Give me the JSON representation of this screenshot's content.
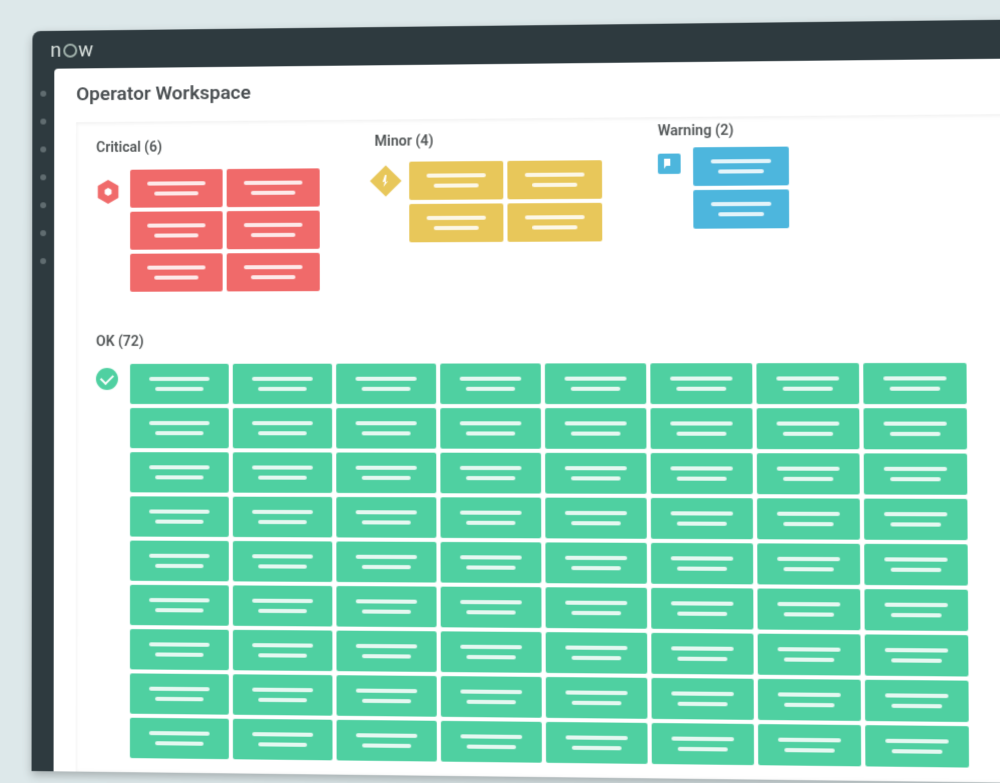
{
  "app": {
    "logo_text": "now"
  },
  "page": {
    "title": "Operator Workspace"
  },
  "groups": {
    "critical": {
      "label": "Critical (6)",
      "count": 6,
      "icon": "critical-hexagon-icon",
      "color": "#f06a6a"
    },
    "minor": {
      "label": "Minor (4)",
      "count": 4,
      "icon": "minor-diamond-icon",
      "color": "#e8c75a"
    },
    "warning": {
      "label": "Warning (2)",
      "count": 2,
      "icon": "warning-flag-icon",
      "color": "#4db6dd"
    },
    "ok": {
      "label": "OK (72)",
      "count": 72,
      "icon": "ok-check-icon",
      "color": "#4fd0a1"
    }
  },
  "visible_counts": {
    "critical": 6,
    "minor": 4,
    "warning": 2,
    "ok": 72
  }
}
